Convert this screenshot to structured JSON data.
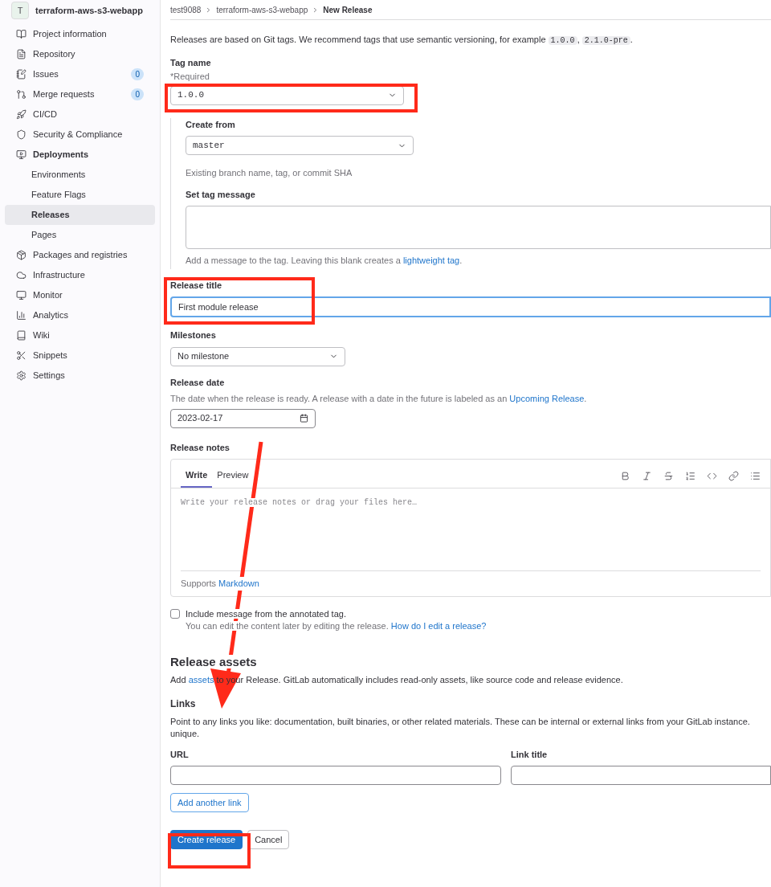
{
  "sidebar": {
    "project_avatar": "T",
    "project_name": "terraform-aws-s3-webapp",
    "items": [
      {
        "label": "Project information",
        "selected": false,
        "expanded": false
      },
      {
        "label": "Repository",
        "selected": false,
        "expanded": false
      },
      {
        "label": "Issues",
        "badge": "0",
        "selected": false,
        "expanded": false
      },
      {
        "label": "Merge requests",
        "badge": "0",
        "selected": false,
        "expanded": false
      },
      {
        "label": "CI/CD",
        "selected": false,
        "expanded": false
      },
      {
        "label": "Security & Compliance",
        "selected": false,
        "expanded": false
      },
      {
        "label": "Deployments",
        "selected": false,
        "expanded": true,
        "children": [
          {
            "label": "Environments",
            "selected": false
          },
          {
            "label": "Feature Flags",
            "selected": false
          },
          {
            "label": "Releases",
            "selected": true
          },
          {
            "label": "Pages",
            "selected": false
          }
        ]
      },
      {
        "label": "Packages and registries",
        "selected": false,
        "expanded": false
      },
      {
        "label": "Infrastructure",
        "selected": false,
        "expanded": false
      },
      {
        "label": "Monitor",
        "selected": false,
        "expanded": false
      },
      {
        "label": "Analytics",
        "selected": false,
        "expanded": false
      },
      {
        "label": "Wiki",
        "selected": false,
        "expanded": false
      },
      {
        "label": "Snippets",
        "selected": false,
        "expanded": false
      },
      {
        "label": "Settings",
        "selected": false,
        "expanded": false
      }
    ]
  },
  "breadcrumb": [
    "test9088",
    "terraform-aws-s3-webapp",
    "New Release"
  ],
  "intro": {
    "before": "Releases are based on Git tags. We recommend tags that use semantic versioning, for example",
    "codes": [
      "1.0.0",
      "2.1.0-pre"
    ],
    "separator": ",",
    "after": "."
  },
  "tag_name": {
    "label": "Tag name",
    "hint": "*Required",
    "value": "1.0.0"
  },
  "create_from": {
    "label": "Create from",
    "value": "master",
    "help": "Existing branch name, tag, or commit SHA"
  },
  "tag_message": {
    "label": "Set tag message",
    "help": "Add a message to the tag. Leaving this blank creates a",
    "link": "lightweight tag",
    "after": "."
  },
  "release_title": {
    "label": "Release title",
    "value": "First module release"
  },
  "milestones": {
    "label": "Milestones",
    "value": "No milestone"
  },
  "release_date": {
    "label": "Release date",
    "help": "The date when the release is ready. A release with a date in the future is labeled as an",
    "link": "Upcoming Release",
    "after": ".",
    "value": "2023-02-17"
  },
  "release_notes": {
    "label": "Release notes",
    "tabs": [
      {
        "label": "Write",
        "selected": true
      },
      {
        "label": "Preview",
        "selected": false
      }
    ],
    "placeholder": "Write your release notes or drag your files here…",
    "footer": "Supports",
    "footer_link": "Markdown"
  },
  "include_message": {
    "label": "Include message from the annotated tag.",
    "checked": false,
    "help": "You can edit the content later by editing the release.",
    "link": "How do I edit a release?"
  },
  "assets": {
    "title": "Release assets",
    "before": "Add",
    "link": "assets",
    "after": "to your Release. GitLab automatically includes read-only assets, like source code and release evidence."
  },
  "links": {
    "title": "Links",
    "text": "Point to any links you like: documentation, built binaries, or other related materials. These can be internal or external links from your GitLab instance. unique.",
    "url_label": "URL",
    "title_label": "Link title",
    "add_button": "Add another link"
  },
  "actions": {
    "primary": "Create release",
    "secondary": "Cancel"
  }
}
